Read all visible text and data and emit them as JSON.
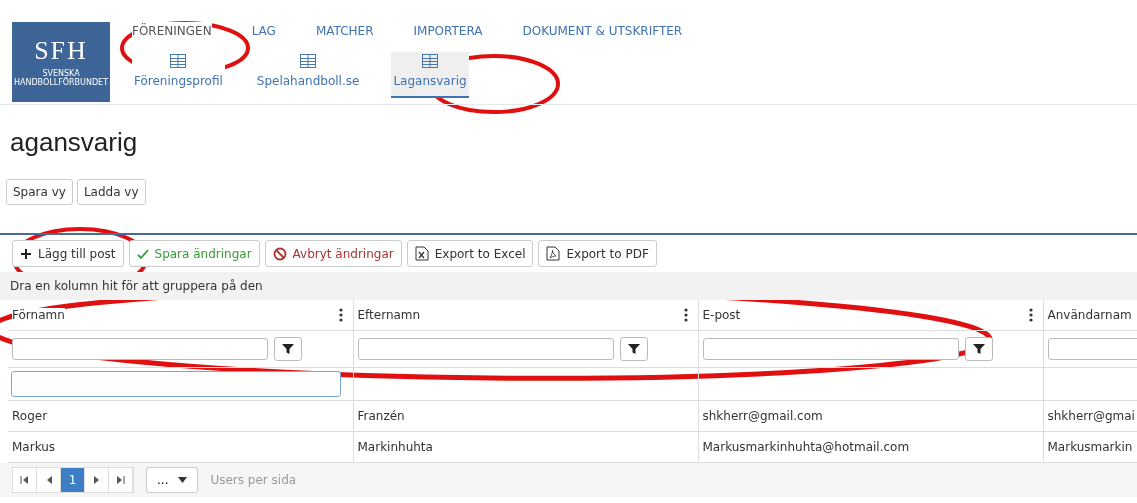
{
  "logo": {
    "monogram": "SFH",
    "caption": "SVENSKA HANDBOLLFÖRBUNDET"
  },
  "main_tabs": [
    {
      "label": "FÖRENINGEN",
      "selected": true
    },
    {
      "label": "LAG",
      "selected": false
    },
    {
      "label": "MATCHER",
      "selected": false
    },
    {
      "label": "IMPORTERA",
      "selected": false
    },
    {
      "label": "DOKUMENT & UTSKRIFTER",
      "selected": false
    }
  ],
  "sub_tabs": [
    {
      "label": "Föreningsprofil",
      "selected": false
    },
    {
      "label": "Spelahandboll.se",
      "selected": false
    },
    {
      "label": "Lagansvarig",
      "selected": true
    }
  ],
  "page_title": "agansvarig",
  "view_buttons": [
    "Spara vy",
    "Ladda vy"
  ],
  "toolbar": [
    {
      "label": "Lägg till post",
      "kind": "add"
    },
    {
      "label": "Spara ändringar",
      "kind": "save"
    },
    {
      "label": "Avbryt ändringar",
      "kind": "cancel"
    },
    {
      "label": "Export to Excel",
      "kind": "excel"
    },
    {
      "label": "Export to PDF",
      "kind": "pdf"
    }
  ],
  "group_hint": "Dra en kolumn hit för att gruppera på den",
  "table": {
    "columns": [
      "Förnamn",
      "Efternamn",
      "E-post",
      "Användarnam"
    ],
    "rows": [
      [
        "Roger",
        "Franzén",
        "shkherr@gmail.com",
        "shkherr@gmai"
      ],
      [
        "Markus",
        "Markinhuhta",
        "Markusmarkinhuhta@hotmail.com",
        "Markusmarkin"
      ]
    ]
  },
  "pager": {
    "pages": [
      {
        "label": "1",
        "selected": true
      }
    ],
    "page_size": "...",
    "size_label": "Users per sida"
  }
}
